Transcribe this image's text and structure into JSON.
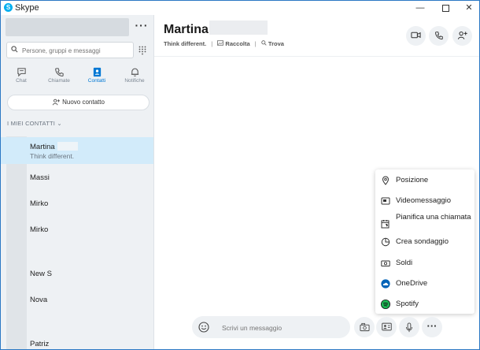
{
  "window": {
    "title": "Skype",
    "logo_letter": "S",
    "minimize": "—",
    "close": "✕"
  },
  "sidebar": {
    "more_label": "···",
    "search": {
      "placeholder": "Persone, gruppi e messaggi",
      "value": ""
    },
    "tabs": [
      {
        "label": "Chat",
        "icon": "chat-icon",
        "active": false
      },
      {
        "label": "Chiamate",
        "icon": "phone-icon",
        "active": false
      },
      {
        "label": "Contatti",
        "icon": "contacts-icon",
        "active": true
      },
      {
        "label": "Notifiche",
        "icon": "bell-icon",
        "active": false
      }
    ],
    "new_contact_label": "Nuovo contatto",
    "section_title": "I MIEI CONTATTI ⌄",
    "contacts": [
      {
        "name": "Martina",
        "status": "Think different.",
        "selected": true
      },
      {
        "name": "Massi",
        "status": ""
      },
      {
        "name": "Mirko",
        "status": ""
      },
      {
        "name": "Mirko",
        "status": ""
      },
      {
        "name": "New S",
        "status": ""
      },
      {
        "name": "Nova",
        "status": ""
      },
      {
        "name": "Patriz",
        "status": ""
      }
    ]
  },
  "chat": {
    "title": "Martina",
    "status": "Think different.",
    "separator": "|",
    "gallery_label": "Raccolta",
    "find_label": "Trova"
  },
  "popup_menu": {
    "items": [
      {
        "label": "Posizione",
        "icon": "location-pin-icon"
      },
      {
        "label": "Videomessaggio",
        "icon": "video-message-icon"
      },
      {
        "label": "Pianifica una chiamata",
        "icon": "schedule-call-icon"
      },
      {
        "label": "Crea sondaggio",
        "icon": "poll-icon"
      },
      {
        "label": "Soldi",
        "icon": "money-icon"
      },
      {
        "label": "OneDrive",
        "icon": "onedrive-icon"
      },
      {
        "label": "Spotify",
        "icon": "spotify-icon"
      }
    ]
  },
  "composer": {
    "placeholder": "Scrivi un messaggio",
    "more_label": "···"
  },
  "colors": {
    "accent": "#0078d4",
    "selected_row": "#d2ebfa",
    "sidebar_bg": "#eef1f4",
    "onedrive": "#0364b8",
    "spotify": "#1ed760"
  }
}
